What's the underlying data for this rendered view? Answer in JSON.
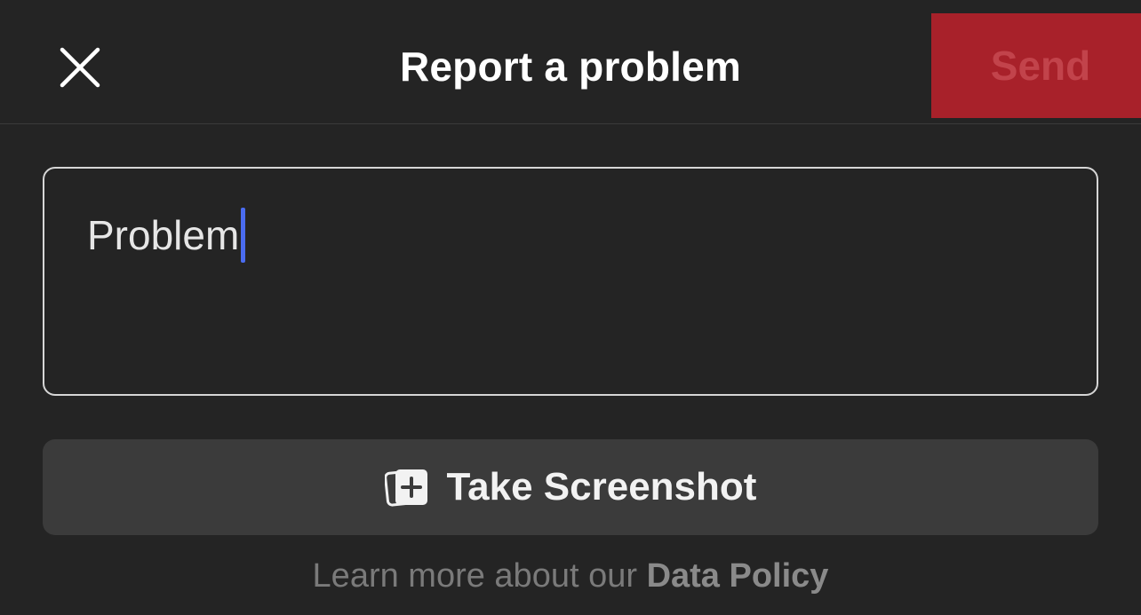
{
  "header": {
    "title": "Report a problem",
    "close_icon": "close-icon",
    "send_label": "Send",
    "send_color": "#a8212a"
  },
  "form": {
    "problem_value": "Problem",
    "caret_color": "#4a6cf0"
  },
  "screenshot_button": {
    "icon": "add-screenshot-icon",
    "label": "Take Screenshot"
  },
  "footer": {
    "text": "Learn more about our ",
    "link_label": "Data Policy"
  }
}
